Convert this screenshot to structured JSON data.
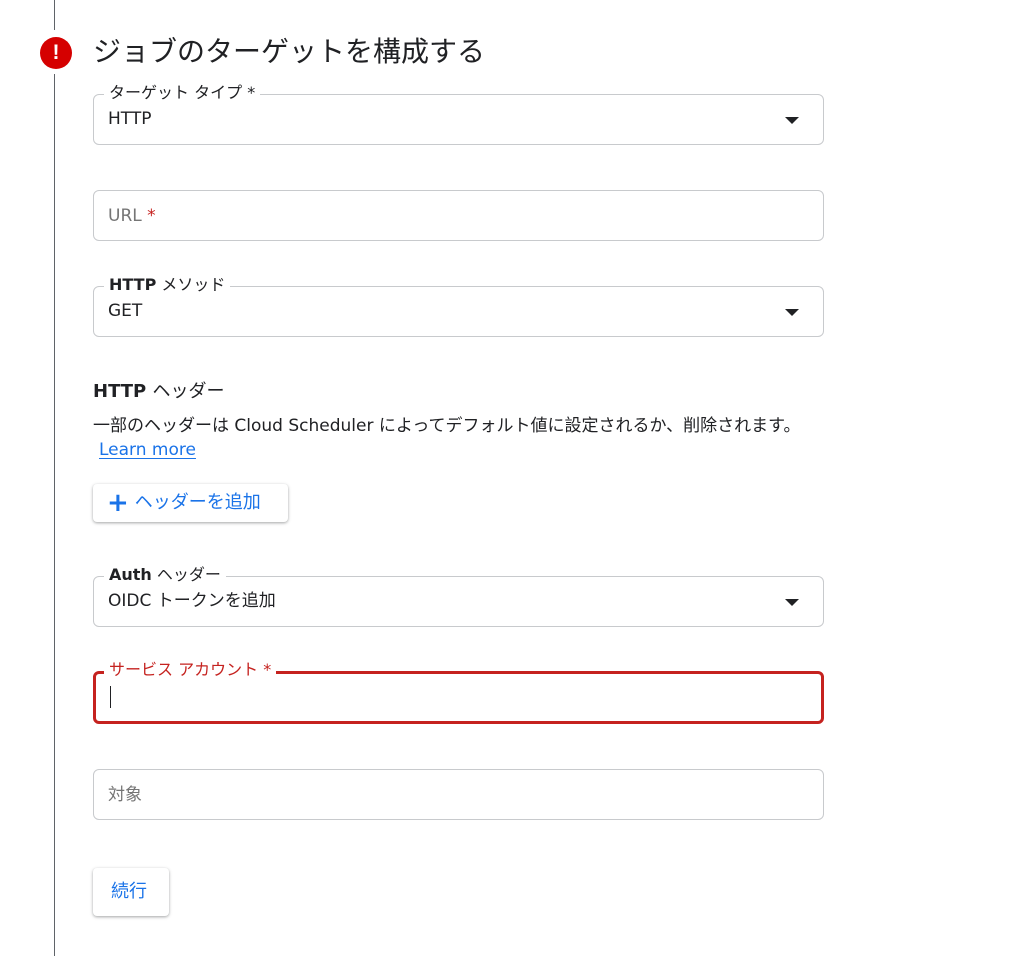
{
  "step": {
    "title": "ジョブのターゲットを構成する",
    "error_icon": "exclamation-icon",
    "error_color": "#d50000"
  },
  "target_type": {
    "label": "ターゲット タイプ",
    "required_mark": "*",
    "value": "HTTP"
  },
  "url": {
    "placeholder": "URL",
    "required_mark": "*"
  },
  "http_method": {
    "label_bold": "HTTP",
    "label": "メソッド",
    "value": "GET"
  },
  "http_headers": {
    "title_bold": "HTTP",
    "title": "ヘッダー",
    "description": "一部のヘッダーは Cloud Scheduler によってデフォルト値に設定されるか、削除されます。",
    "learn_more": "Learn more",
    "add_button": "ヘッダーを追加"
  },
  "auth_header": {
    "label_bold": "Auth",
    "label": "ヘッダー",
    "value": "OIDC トークンを追加"
  },
  "service_account": {
    "label": "サービス アカウント",
    "required_mark": "*",
    "value": ""
  },
  "audience": {
    "placeholder": "対象"
  },
  "continue_button": "続行",
  "colors": {
    "accent": "#1a73e8",
    "error": "#c5221f",
    "border": "#c8cacd"
  }
}
